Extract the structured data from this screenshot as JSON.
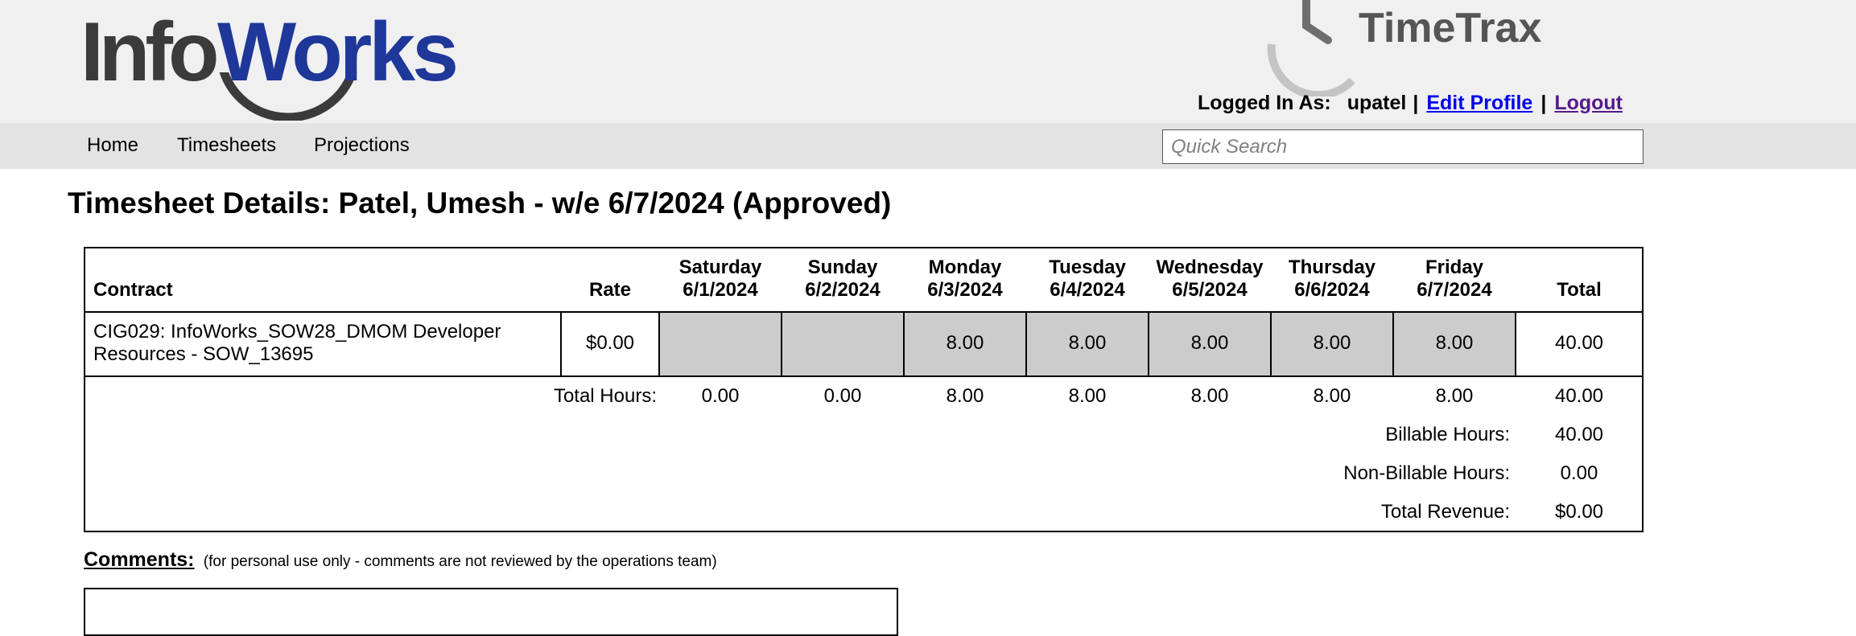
{
  "header": {
    "logo_text_left": "Info",
    "logo_text_right": "Works",
    "app_logo_text": "TimeTrax",
    "logged_in_label": "Logged In As:",
    "username": "upatel",
    "separator": "|",
    "edit_profile_label": "Edit Profile",
    "logout_label": "Logout"
  },
  "nav": {
    "items": [
      "Home",
      "Timesheets",
      "Projections"
    ],
    "search_placeholder": "Quick Search"
  },
  "page_title": "Timesheet Details: Patel, Umesh - w/e 6/7/2024 (Approved)",
  "table": {
    "headers": {
      "contract": "Contract",
      "rate": "Rate",
      "days": [
        {
          "day": "Saturday",
          "date": "6/1/2024"
        },
        {
          "day": "Sunday",
          "date": "6/2/2024"
        },
        {
          "day": "Monday",
          "date": "6/3/2024"
        },
        {
          "day": "Tuesday",
          "date": "6/4/2024"
        },
        {
          "day": "Wednesday",
          "date": "6/5/2024"
        },
        {
          "day": "Thursday",
          "date": "6/6/2024"
        },
        {
          "day": "Friday",
          "date": "6/7/2024"
        }
      ],
      "total": "Total"
    },
    "row": {
      "contract": "CIG029: InfoWorks_SOW28_DMOM Developer Resources - SOW_13695",
      "rate": "$0.00",
      "hours": [
        "",
        "",
        "8.00",
        "8.00",
        "8.00",
        "8.00",
        "8.00"
      ],
      "total": "40.00"
    },
    "totals": {
      "label": "Total Hours:",
      "hours": [
        "0.00",
        "0.00",
        "8.00",
        "8.00",
        "8.00",
        "8.00",
        "8.00"
      ],
      "total": "40.00"
    },
    "summary": {
      "billable_label": "Billable Hours:",
      "billable_value": "40.00",
      "non_billable_label": "Non-Billable Hours:",
      "non_billable_value": "0.00",
      "revenue_label": "Total Revenue:",
      "revenue_value": "$0.00"
    }
  },
  "comments": {
    "heading": "Comments:",
    "note": "(for personal use only - comments are not reviewed by the operations team)"
  },
  "colors": {
    "logo_blue": "#1e3799",
    "logo_dark": "#3b3b3b",
    "link": "#0000ee",
    "visited_link": "#551a8b",
    "cell_gray": "#cccccc",
    "header_bg": "#f0f0f0",
    "nav_bg": "#e3e3e3"
  }
}
